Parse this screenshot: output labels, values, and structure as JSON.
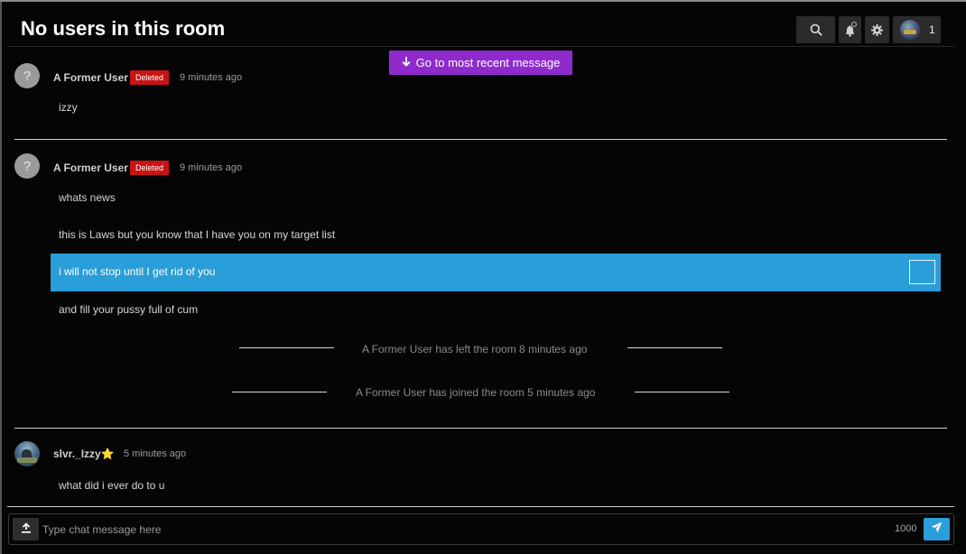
{
  "header": {
    "title": "No users in this room",
    "user_count": "1",
    "icons": [
      "search-icon",
      "bell-icon",
      "gear-icon",
      "user-avatar-icon"
    ]
  },
  "jump_button": {
    "label": "Go to most recent message",
    "color": "#8f2bcc"
  },
  "messages": [
    {
      "author": "A Former User",
      "badge": "Deleted",
      "timestamp": "9 minutes ago",
      "lines": [
        "izzy"
      ]
    },
    {
      "author": "A Former User",
      "badge": "Deleted",
      "timestamp": "9 minutes ago",
      "lines": [
        "whats news",
        "this is Laws but you know that I have you on my target list",
        "i will not stop until I get rid of you",
        "and fill your pussy full of cum"
      ],
      "highlighted_line": "i will not stop until I get rid of you"
    },
    {
      "author": "slvr._Izzy⭐",
      "timestamp": "5 minutes ago",
      "lines": [
        "what did i ever do to u"
      ]
    }
  ],
  "system_events": [
    "A Former User has left the room 8 minutes ago",
    "A Former User has joined the room 5 minutes ago"
  ],
  "composer": {
    "placeholder": "Type chat message here",
    "char_limit": "1000"
  },
  "colors": {
    "background": "#050506",
    "highlight": "#2a9ed8",
    "deleted_badge": "#c81414",
    "send_button": "#2a9ed8"
  }
}
